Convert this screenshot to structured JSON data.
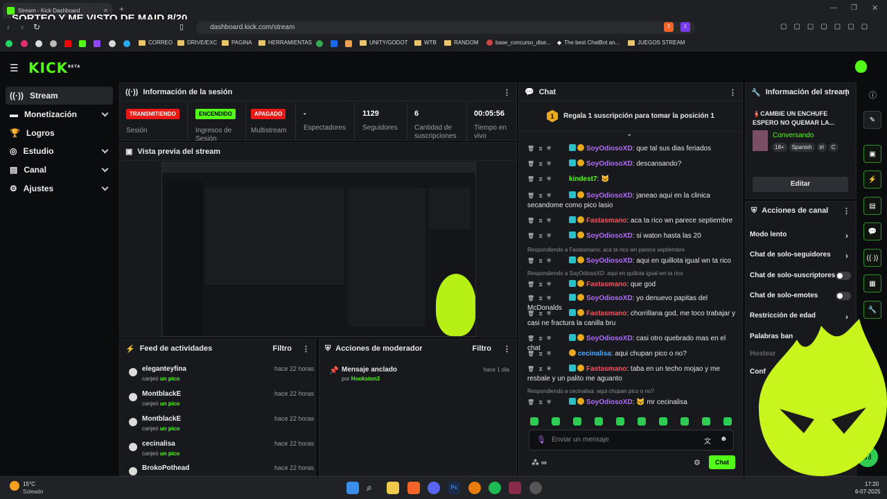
{
  "browser": {
    "tab_title": "Stream - Kick Dashboard",
    "new_tab": "+",
    "overlay_title": "SORTEO Y ME VISTO DE MAID 8/20",
    "url": "dashboard.kick.com/stream",
    "ext_count_a": "2",
    "ext_count_b": "1",
    "bookmarks": [
      "CORREO",
      "DRIVE/EXC",
      "PAGINA",
      "HERRAMIENTAS",
      "UNITY/GODOT",
      "WTB",
      "RANDOM",
      "base_concurso_dise...",
      "The best ChatBot an...",
      "JUEGOS STREAM"
    ]
  },
  "app": {
    "logo": "KICK",
    "logo_beta": "BETA",
    "nav": [
      {
        "label": "Stream",
        "icon": "broadcast-icon"
      },
      {
        "label": "Monetización",
        "icon": "money-icon"
      },
      {
        "label": "Logros",
        "icon": "trophy-icon"
      },
      {
        "label": "Estudio",
        "icon": "studio-icon"
      },
      {
        "label": "Canal",
        "icon": "channel-icon"
      },
      {
        "label": "Ajustes",
        "icon": "settings-icon"
      }
    ]
  },
  "session": {
    "title": "Información de la sesión",
    "badges": [
      {
        "text": "TRANSMITIENDO",
        "label": "Sesión",
        "color": "#e91916"
      },
      {
        "text": "ENCENDIDO",
        "label": "Ingresos de Sesión",
        "color": "#53fc18"
      },
      {
        "text": "APAGADO",
        "label": "Multistream",
        "color": "#e91916"
      }
    ],
    "stats": [
      {
        "value": "-",
        "label": "Espectadores"
      },
      {
        "value": "1129",
        "label": "Seguidores"
      },
      {
        "value": "6",
        "label": "Cantidad de suscripciones"
      },
      {
        "value": "00:05:56",
        "label": "Tiempo en vivo"
      }
    ]
  },
  "preview": {
    "title": "Vista previa del stream"
  },
  "feed": {
    "title": "Feed de actividades",
    "filter": "Filtro",
    "items": [
      {
        "name": "eleganteyfina",
        "action": "canjeó",
        "reward": "un pico",
        "time": "hace 22 horas"
      },
      {
        "name": "MontblackE",
        "action": "canjeó",
        "reward": "un pico",
        "time": "hace 22 horas"
      },
      {
        "name": "MontblackE",
        "action": "canjeó",
        "reward": "un pico",
        "time": "hace 22 horas"
      },
      {
        "name": "cecinalisa",
        "action": "canjeó",
        "reward": "un pico",
        "time": "hace 22 horas"
      },
      {
        "name": "BrokoPothead",
        "action": "",
        "reward": "",
        "time": "hace 22 horas"
      }
    ]
  },
  "mod": {
    "title": "Acciones de moderador",
    "filter": "Filtro",
    "item_title": "Mensaje anclado",
    "item_by": "por",
    "item_user": "Hookston3",
    "item_time": "hace 1 día"
  },
  "chat": {
    "title": "Chat",
    "gift_badge": "1",
    "gift_text": "Regala 1 suscripción para tomar la posición 1",
    "messages": [
      {
        "user": "SoyOdiosoXD",
        "color": "p",
        "text": ": que tal sus dias feriados"
      },
      {
        "user": "SoyOdiosoXD",
        "color": "p",
        "text": ": descansando?"
      },
      {
        "user": "kindest7",
        "color": "g",
        "text": ": 🐱"
      },
      {
        "user": "SoyOdiosoXD",
        "color": "p",
        "text": ": janeao aqui en la clinica secandome como pico lasio"
      },
      {
        "user": "Fastasmano",
        "color": "r",
        "text": ": aca ta rico wn parece septiembre"
      },
      {
        "user": "SoyOdiosoXD",
        "color": "p",
        "text": ": si waton hasta las 20"
      },
      {
        "reply": "Respondiendo a Fastasmano: aca ta rico wn parece septiembre"
      },
      {
        "user": "SoyOdiosoXD",
        "color": "p",
        "text": ": aqui en quillota igual wn ta rico"
      },
      {
        "reply": "Respondiendo a SoyOdiosoXD: aqui en quillota igual wn ta rico"
      },
      {
        "user": "Fastasmano",
        "color": "r",
        "text": ": que god"
      },
      {
        "user": "SoyOdiosoXD",
        "color": "p",
        "text": ": yo denuevo papitas del McDonalds"
      },
      {
        "user": "Fastasmano",
        "color": "r",
        "text": ": chorrillana god, me toco trabajar y casi ne fractura la canilla bru"
      },
      {
        "user": "SoyOdiosoXD",
        "color": "p",
        "text": ": casi otro quebrado mas en el chat"
      },
      {
        "user": "cecinalisa",
        "color": "b",
        "text": ": aqui chupan pico o no?"
      },
      {
        "user": "Fastasmano",
        "color": "r",
        "text": ": taba en un techo mojao y me resbale y un palito me aguanto"
      },
      {
        "reply": "Respondiendo a cecinalisa: aqui chupan pico o no?"
      },
      {
        "user": "SoyOdiosoXD",
        "color": "p",
        "text": ": 🐱 mr cecinalisa"
      }
    ],
    "placeholder": "Enviar un mensaje",
    "send": "Chat"
  },
  "stream_info": {
    "title": "Información del stream",
    "stream_title": "🧯CAMBIE UN ENCHUFE ESPERO NO QUEMAR LA...",
    "category": "Conversando",
    "tags": [
      "18+",
      "Spanish",
      "irl",
      "C"
    ],
    "edit": "Editar"
  },
  "channel_actions": {
    "title": "Acciones de canal",
    "items": [
      {
        "label": "Modo lento",
        "type": "chevron"
      },
      {
        "label": "Chat de solo-seguidores",
        "type": "chevron"
      },
      {
        "label": "Chat de solo-suscriptores",
        "type": "toggle"
      },
      {
        "label": "Chat de solo-emotes",
        "type": "toggle"
      },
      {
        "label": "Restricción de edad",
        "type": "chevron"
      },
      {
        "label": "Palabras ban",
        "type": "none"
      },
      {
        "label": "Hostear",
        "type": "none"
      },
      {
        "label": "Conf",
        "type": "none"
      }
    ]
  },
  "taskbar": {
    "temp": "15°C",
    "weather": "Soleado",
    "time": "17:20",
    "date": "6-07-2025"
  },
  "colors": {
    "brand": "#53fc18",
    "live": "#e91916",
    "panel": "#18191c"
  }
}
